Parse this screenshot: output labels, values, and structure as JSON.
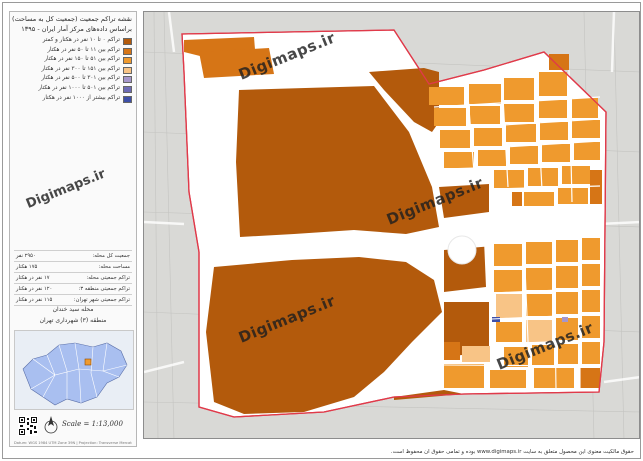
{
  "legend": {
    "title_line1": "نقشه تراکم جمعیت (جمعیت کل به مساحت)",
    "title_line2": "براساس داده‌های مرکز آمار ایران - ۱۳۹۵",
    "items": [
      {
        "label": "تراکم ۰ تا ۱۰ نفر در هکتار و کمتر",
        "color": "#b35a0c"
      },
      {
        "label": "تراکم بین ۱۱ تا ۵۰ نفر در هکتار",
        "color": "#d67516"
      },
      {
        "label": "تراکم بین ۵۱ تا ۱۵۰ نفر در هکتار",
        "color": "#ef9a2e"
      },
      {
        "label": "تراکم بین ۱۵۱ تا ۳۰۰ نفر در هکتار",
        "color": "#f8c486"
      },
      {
        "label": "تراکم بین ۳۰۱ تا ۵۰۰ نفر در هکتار",
        "color": "#a596cc"
      },
      {
        "label": "تراکم بین ۵۰۱ تا ۱۰۰۰ نفر در هکتار",
        "color": "#6c6ab5"
      },
      {
        "label": "تراکم بیشتر از ۱۰۰۰ نفر در هکتار",
        "color": "#3e4fa8"
      }
    ]
  },
  "stats": [
    {
      "label": "جمعیت کل محله:",
      "value": "۲۹۵۰ نفر"
    },
    {
      "label": "مساحت محله:",
      "value": "۱۷۵ هکتار"
    },
    {
      "label": "تراکم جمعیتی محله:",
      "value": "۱۷ نفر در هکتار"
    },
    {
      "label": "تراکم جمعیتی منطقه ۳:",
      "value": "۱۲۰ نفر در هکتار"
    },
    {
      "label": "تراکم جمعیتی شهر تهران:",
      "value": "۱۱۵ نفر در هکتار"
    }
  ],
  "locator": {
    "title": "محله سید خندان",
    "subtitle": "منطقه (۳) شهرداری تهران"
  },
  "scale_text": "Scale = 1:13,000",
  "north_letter": "N",
  "credit": "Datum: WGS 1984 UTM Zone 39N | Projection: Transverse Mercator",
  "footer_text": "حقوق مالکیت معنوی این محصول متعلق به سایت www.digimaps.ir بوده و تمامی حقوق آن محفوظ است.",
  "watermark": "Digimaps.ir",
  "colors": {
    "boundary": "#e03a4a",
    "very_low": "#b35a0c",
    "low": "#d67516",
    "mid": "#ef9a2e",
    "high": "#f8c486",
    "purple": "#a596cc",
    "blue": "#3e4fa8",
    "road": "#ffffff",
    "basemap": "#d9d9d6"
  }
}
